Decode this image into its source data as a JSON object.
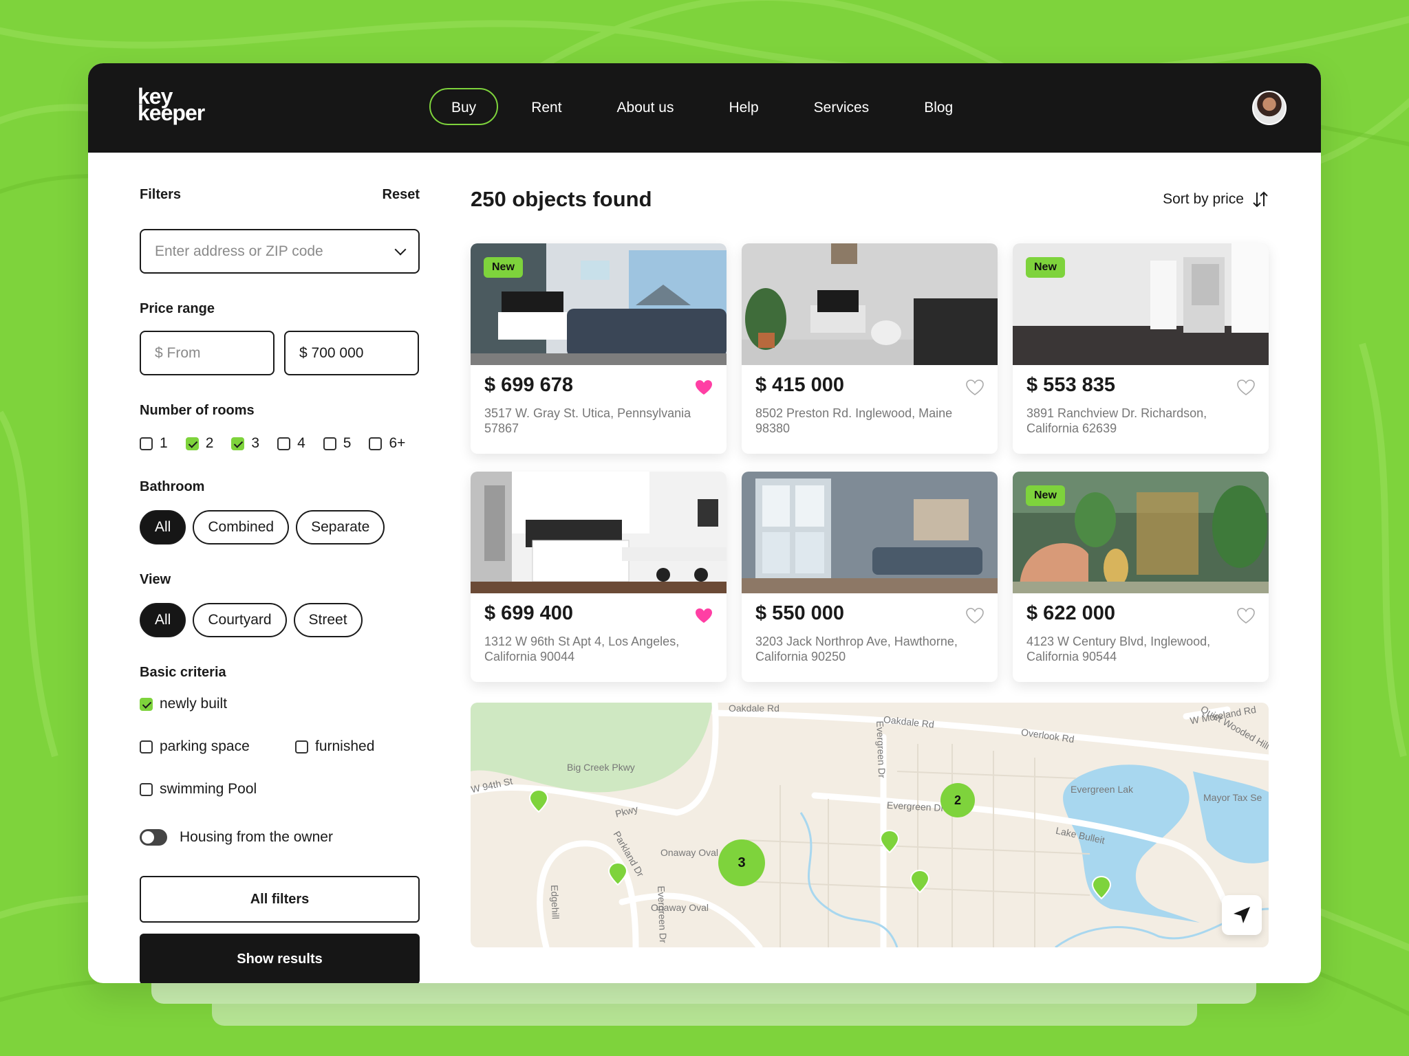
{
  "app": {
    "logo_line1": "key",
    "logo_line2": "keeper"
  },
  "nav": {
    "items": [
      "Buy",
      "Rent",
      "About us",
      "Help",
      "Services",
      "Blog"
    ],
    "active": "Buy"
  },
  "filters": {
    "title": "Filters",
    "reset": "Reset",
    "search_placeholder": "Enter address or ZIP code",
    "price_range": {
      "title": "Price range",
      "from_placeholder": "$ From",
      "to_value": "$ 700 000"
    },
    "rooms": {
      "title": "Number of rooms",
      "options": [
        {
          "label": "1",
          "checked": false
        },
        {
          "label": "2",
          "checked": true
        },
        {
          "label": "3",
          "checked": true
        },
        {
          "label": "4",
          "checked": false
        },
        {
          "label": "5",
          "checked": false
        },
        {
          "label": "6+",
          "checked": false
        }
      ]
    },
    "bathroom": {
      "title": "Bathroom",
      "options": [
        "All",
        "Combined",
        "Separate"
      ],
      "selected": "All"
    },
    "view": {
      "title": "View",
      "options": [
        "All",
        "Courtyard",
        "Street"
      ],
      "selected": "All"
    },
    "criteria": {
      "title": "Basic criteria",
      "options": [
        {
          "label": "newly built",
          "checked": true
        },
        {
          "label": "parking space",
          "checked": false
        },
        {
          "label": "furnished",
          "checked": false
        },
        {
          "label": "swimming Pool",
          "checked": false
        }
      ]
    },
    "owner_toggle": {
      "label": "Housing from the owner",
      "on": false
    },
    "all_filters": "All filters",
    "show_results": "Show results"
  },
  "results": {
    "title": "250 objects found",
    "sort_label": "Sort by price",
    "listings": [
      {
        "price": "$ 699 678",
        "address": "3517 W. Gray St. Utica, Pennsylvania 57867",
        "badge": "New",
        "favorite": true
      },
      {
        "price": "$ 415 000",
        "address": "8502 Preston Rd. Inglewood, Maine 98380",
        "badge": "",
        "favorite": false
      },
      {
        "price": "$ 553 835",
        "address": "3891 Ranchview Dr. Richardson, California 62639",
        "badge": "New",
        "favorite": false
      },
      {
        "price": "$ 699 400",
        "address": "1312 W 96th St Apt 4, Los Angeles, California 90044",
        "badge": "",
        "favorite": true
      },
      {
        "price": "$ 550 000",
        "address": "3203 Jack Northrop Ave, Hawthorne, California 90250",
        "badge": "",
        "favorite": false
      },
      {
        "price": "$ 622 000",
        "address": "4123 W Century Blvd, Inglewood, California 90544",
        "badge": "New",
        "favorite": false
      }
    ]
  },
  "map": {
    "labels": [
      "Oakdale Rd",
      "Oakdale Rd",
      "Overlook Rd",
      "W Moreland Rd",
      "Quiet Wooded Hill",
      "Big Creek Pkwy",
      "Pkwy",
      "W 94th St",
      "Evergreen Dr",
      "Evergreen Dr",
      "Lake Bulleit",
      "Evergreen Lak",
      "Mayor Tax Se",
      "Onaway Oval",
      "Parkland Dr",
      "Onaway Oval",
      "Edgehill",
      "Evergreen Dr"
    ],
    "clusters": [
      "3",
      "2"
    ]
  },
  "colors": {
    "accent": "#7ed33c",
    "dark": "#161616",
    "heart_active": "#ff3fa4"
  }
}
